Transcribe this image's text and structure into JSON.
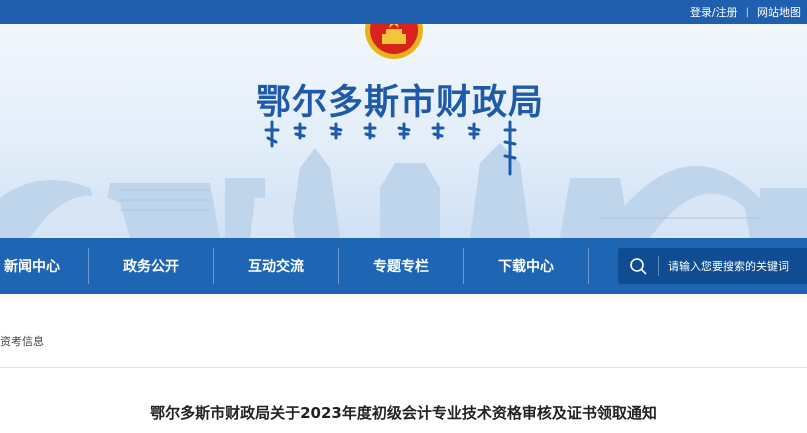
{
  "topbar": {
    "login_label": "登录/注册",
    "separator": "|",
    "sitemap_label": "网站地图"
  },
  "banner": {
    "title": "鄂尔多斯市财政局"
  },
  "nav": {
    "items": [
      "新闻中心",
      "政务公开",
      "互动交流",
      "专题专栏",
      "下载中心"
    ]
  },
  "search": {
    "placeholder": "请输入您要搜索的关键词"
  },
  "breadcrumb": {
    "text": "资考信息"
  },
  "article": {
    "title": "鄂尔多斯市财政局关于2023年度初级会计专业技术资格审核及证书领取通知"
  },
  "colors": {
    "brand_blue": "#1e65b4",
    "title_blue": "#1d5ba8"
  },
  "icons": [
    "emblem",
    "search-icon"
  ]
}
